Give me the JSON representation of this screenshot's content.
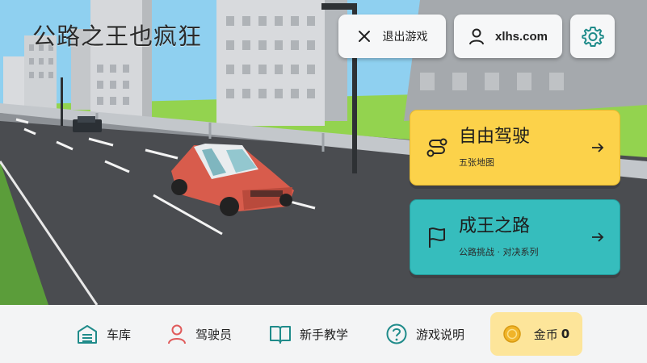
{
  "header": {
    "title": "公路之王也疯狂"
  },
  "top_buttons": {
    "exit": {
      "label": "退出游戏",
      "icon": "close-icon"
    },
    "account": {
      "label": "xlhs.com",
      "icon": "user-icon"
    },
    "settings": {
      "icon": "gear-icon"
    }
  },
  "modes": [
    {
      "title": "自由驾驶",
      "subtitle": "五张地图",
      "icon": "route-icon",
      "color": "#fcd24a"
    },
    {
      "title": "成王之路",
      "subtitle": "公路挑战 · 对决系列",
      "icon": "flag-icon",
      "color": "#36bdbd"
    }
  ],
  "bottom_nav": [
    {
      "label": "车库",
      "icon": "garage-icon"
    },
    {
      "label": "驾驶员",
      "icon": "driver-icon"
    },
    {
      "label": "新手教学",
      "icon": "book-icon"
    },
    {
      "label": "游戏说明",
      "icon": "help-icon"
    }
  ],
  "coins": {
    "label": "金币",
    "value": "0",
    "icon": "coin-icon"
  },
  "colors": {
    "accent_teal": "#2a9d9a",
    "accent_red": "#e05a5a",
    "coin": "#f0b429"
  }
}
